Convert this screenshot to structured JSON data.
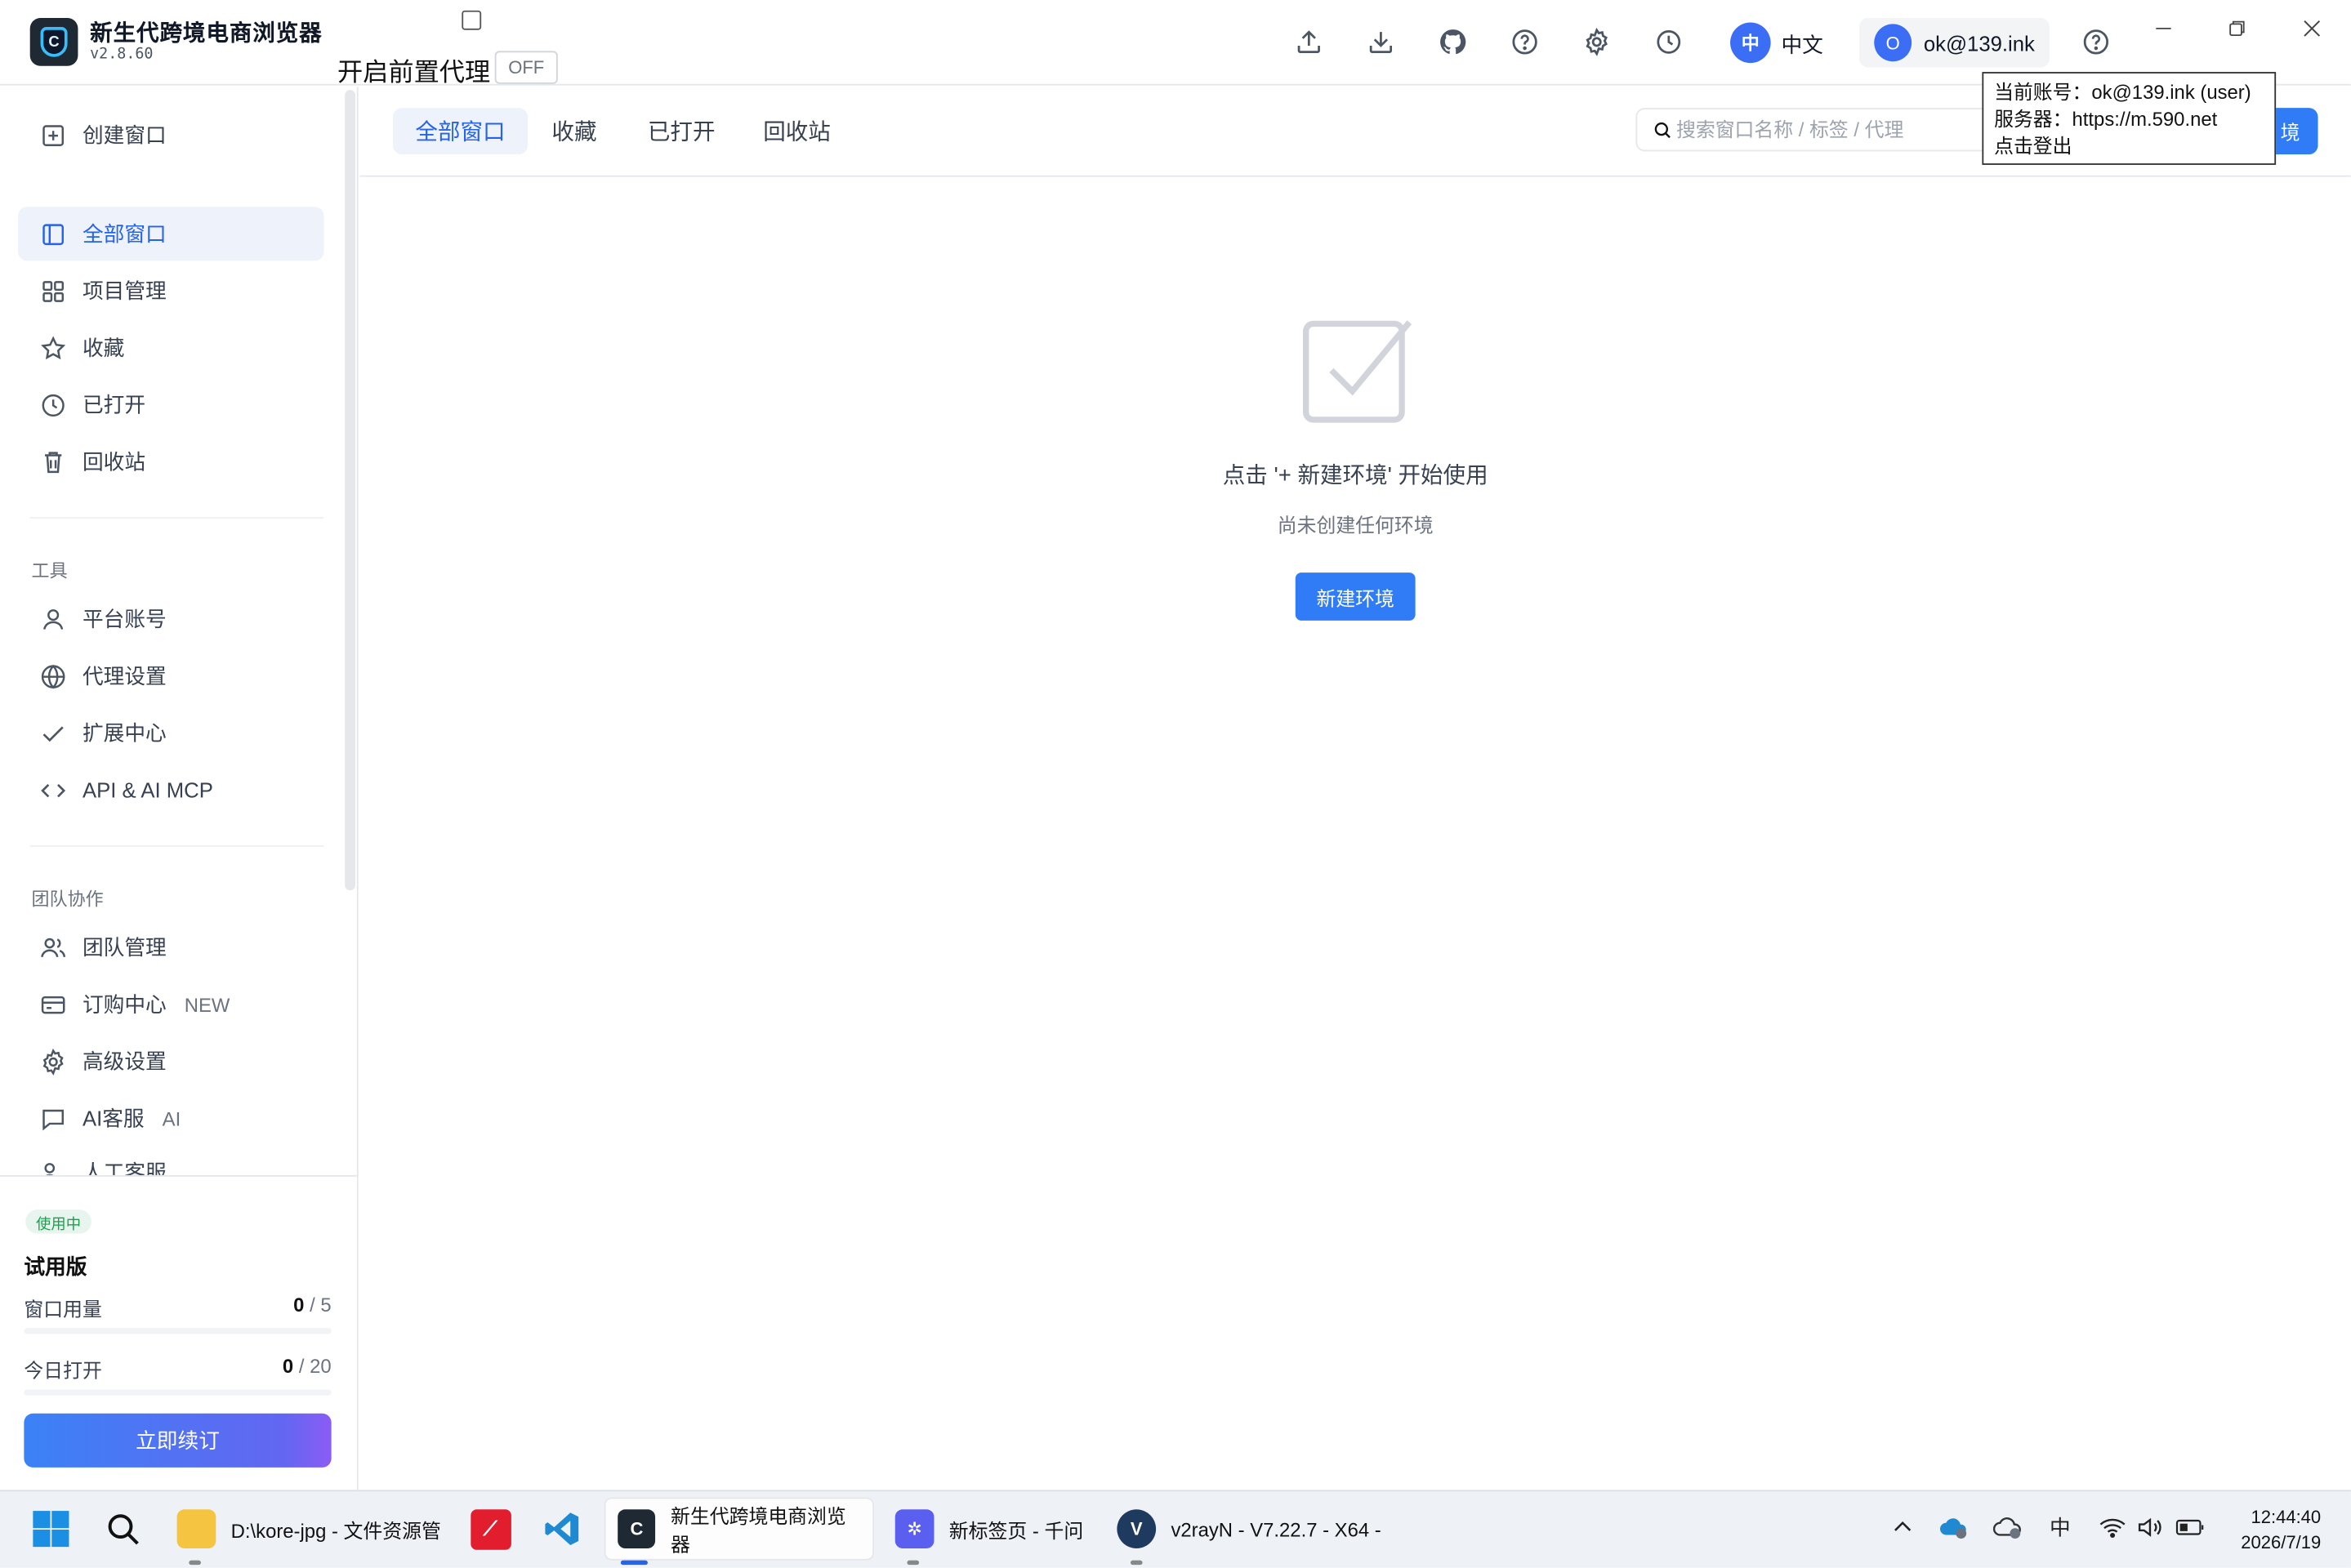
{
  "app": {
    "title": "新生代跨境电商浏览器",
    "version": "v2.8.60",
    "proxy_label": "开启前置代理",
    "proxy_toggle": "OFF"
  },
  "header": {
    "lang_badge": "中",
    "lang_label": "中文",
    "account_avatar": "O",
    "account_label": "ok@139.ink",
    "icons": [
      "upload-icon",
      "download-icon",
      "github-icon",
      "help-icon",
      "settings-icon",
      "history-icon",
      "help-icon"
    ]
  },
  "tooltip": {
    "line1": "当前账号：ok@139.ink (user)",
    "line2": "服务器：https://m.590.net",
    "line3": "点击登出"
  },
  "sidebar": {
    "create": "创建窗口",
    "nav": [
      "全部窗口",
      "项目管理",
      "收藏",
      "已打开",
      "回收站"
    ],
    "tools_title": "工具",
    "tools": [
      "平台账号",
      "代理设置",
      "扩展中心",
      "API & AI MCP"
    ],
    "team_title": "团队协作",
    "team": [
      "团队管理",
      "订购中心",
      "高级设置",
      "AI客服",
      "人工客服"
    ],
    "team_tags": [
      "",
      "NEW",
      "",
      "AI",
      ""
    ]
  },
  "plan": {
    "badge": "使用中",
    "name": "试用版",
    "window_usage_label": "窗口用量",
    "window_used": "0",
    "window_total": " / 5",
    "window_fraction": 0,
    "open_today_label": "今日打开",
    "open_used": "0",
    "open_total": " / 20",
    "open_fraction": 0,
    "renew": "立即续订"
  },
  "main": {
    "tabs": [
      "全部窗口",
      "收藏",
      "已打开",
      "回收站"
    ],
    "search_placeholder": "搜索窗口名称 / 标签 / 代理",
    "new_env_partial": "境",
    "empty_title": "点击 '+ 新建环境' 开始使用",
    "empty_sub": "尚未创建任何环境",
    "empty_button": "新建环境"
  },
  "taskbar": {
    "apps": [
      "D:\\kore-jpg - 文件资源管",
      "新生代跨境电商浏览器",
      "新标签页 - 千问",
      "v2rayN - V7.22.7 - X64 -"
    ],
    "ime": "中",
    "time": "12:44:40",
    "date": "2026/7/19"
  },
  "colors": {
    "accent": "#2f7cf6",
    "active_bg": "#eef2fb",
    "badge_green": "#16a34a"
  }
}
